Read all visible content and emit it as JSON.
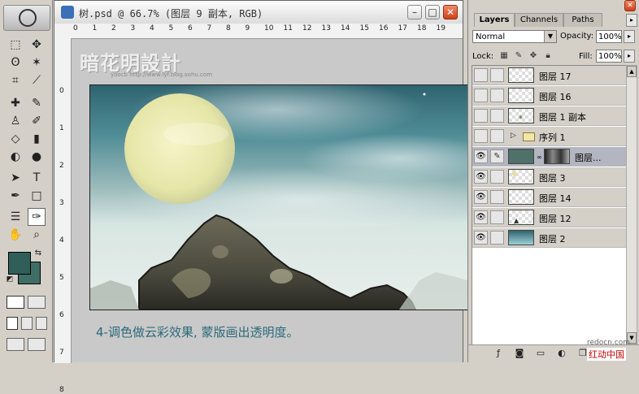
{
  "document": {
    "title": "树.psd @ 66.7% (图层 9 副本, RGB)",
    "watermark": "暗花明設計",
    "watermark_sub": "yoocb    http://www.lyf.blog.sohu.com",
    "caption": "4-调色做云彩效果, 蒙版画出透明度。",
    "h_ruler_numbers": [
      "0",
      "1",
      "2",
      "3",
      "4",
      "5",
      "6",
      "7",
      "8",
      "9",
      "10",
      "11",
      "12",
      "13",
      "14",
      "15",
      "16",
      "17",
      "18",
      "19"
    ],
    "v_ruler_numbers": [
      "0",
      "1",
      "2",
      "3",
      "4",
      "5",
      "6",
      "7",
      "8"
    ]
  },
  "tools": {
    "foreground_color": "#2f5f58",
    "background_color": "#3e6e66",
    "icons": [
      "marquee-icon",
      "move-icon",
      "lasso-icon",
      "magic-wand-icon",
      "crop-icon",
      "slice-icon",
      "healing-icon",
      "brush-icon",
      "stamp-icon",
      "history-brush-icon",
      "eraser-icon",
      "gradient-icon",
      "blur-icon",
      "dodge-icon",
      "path-select-icon",
      "type-icon",
      "pen-icon",
      "shape-icon",
      "notes-icon",
      "eyedropper-icon",
      "hand-icon",
      "zoom-icon"
    ]
  },
  "layers_panel": {
    "tabs": [
      "Layers",
      "Channels",
      "Paths"
    ],
    "blend_mode": "Normal",
    "opacity_label": "Opacity:",
    "opacity_value": "100%",
    "lock_label": "Lock:",
    "fill_label": "Fill:",
    "fill_value": "100%",
    "layers": [
      {
        "name": "图层 17",
        "visible": false
      },
      {
        "name": "图层 16",
        "visible": false
      },
      {
        "name": "图层 1 副本",
        "visible": false
      },
      {
        "name": "序列 1",
        "visible": false,
        "group": true
      },
      {
        "name": "图层...",
        "visible": true,
        "active": true,
        "mask": true
      },
      {
        "name": "图层 3",
        "visible": true
      },
      {
        "name": "图层 14",
        "visible": true
      },
      {
        "name": "图层 12",
        "visible": true
      },
      {
        "name": "图层 2",
        "visible": true
      }
    ],
    "watermark_site": "redocn.com",
    "watermark_cn": "红动中国"
  },
  "colors": {
    "sky_top": "#2f6470",
    "caption": "#2b6a7a",
    "active_layer": "#b3b6c0"
  }
}
